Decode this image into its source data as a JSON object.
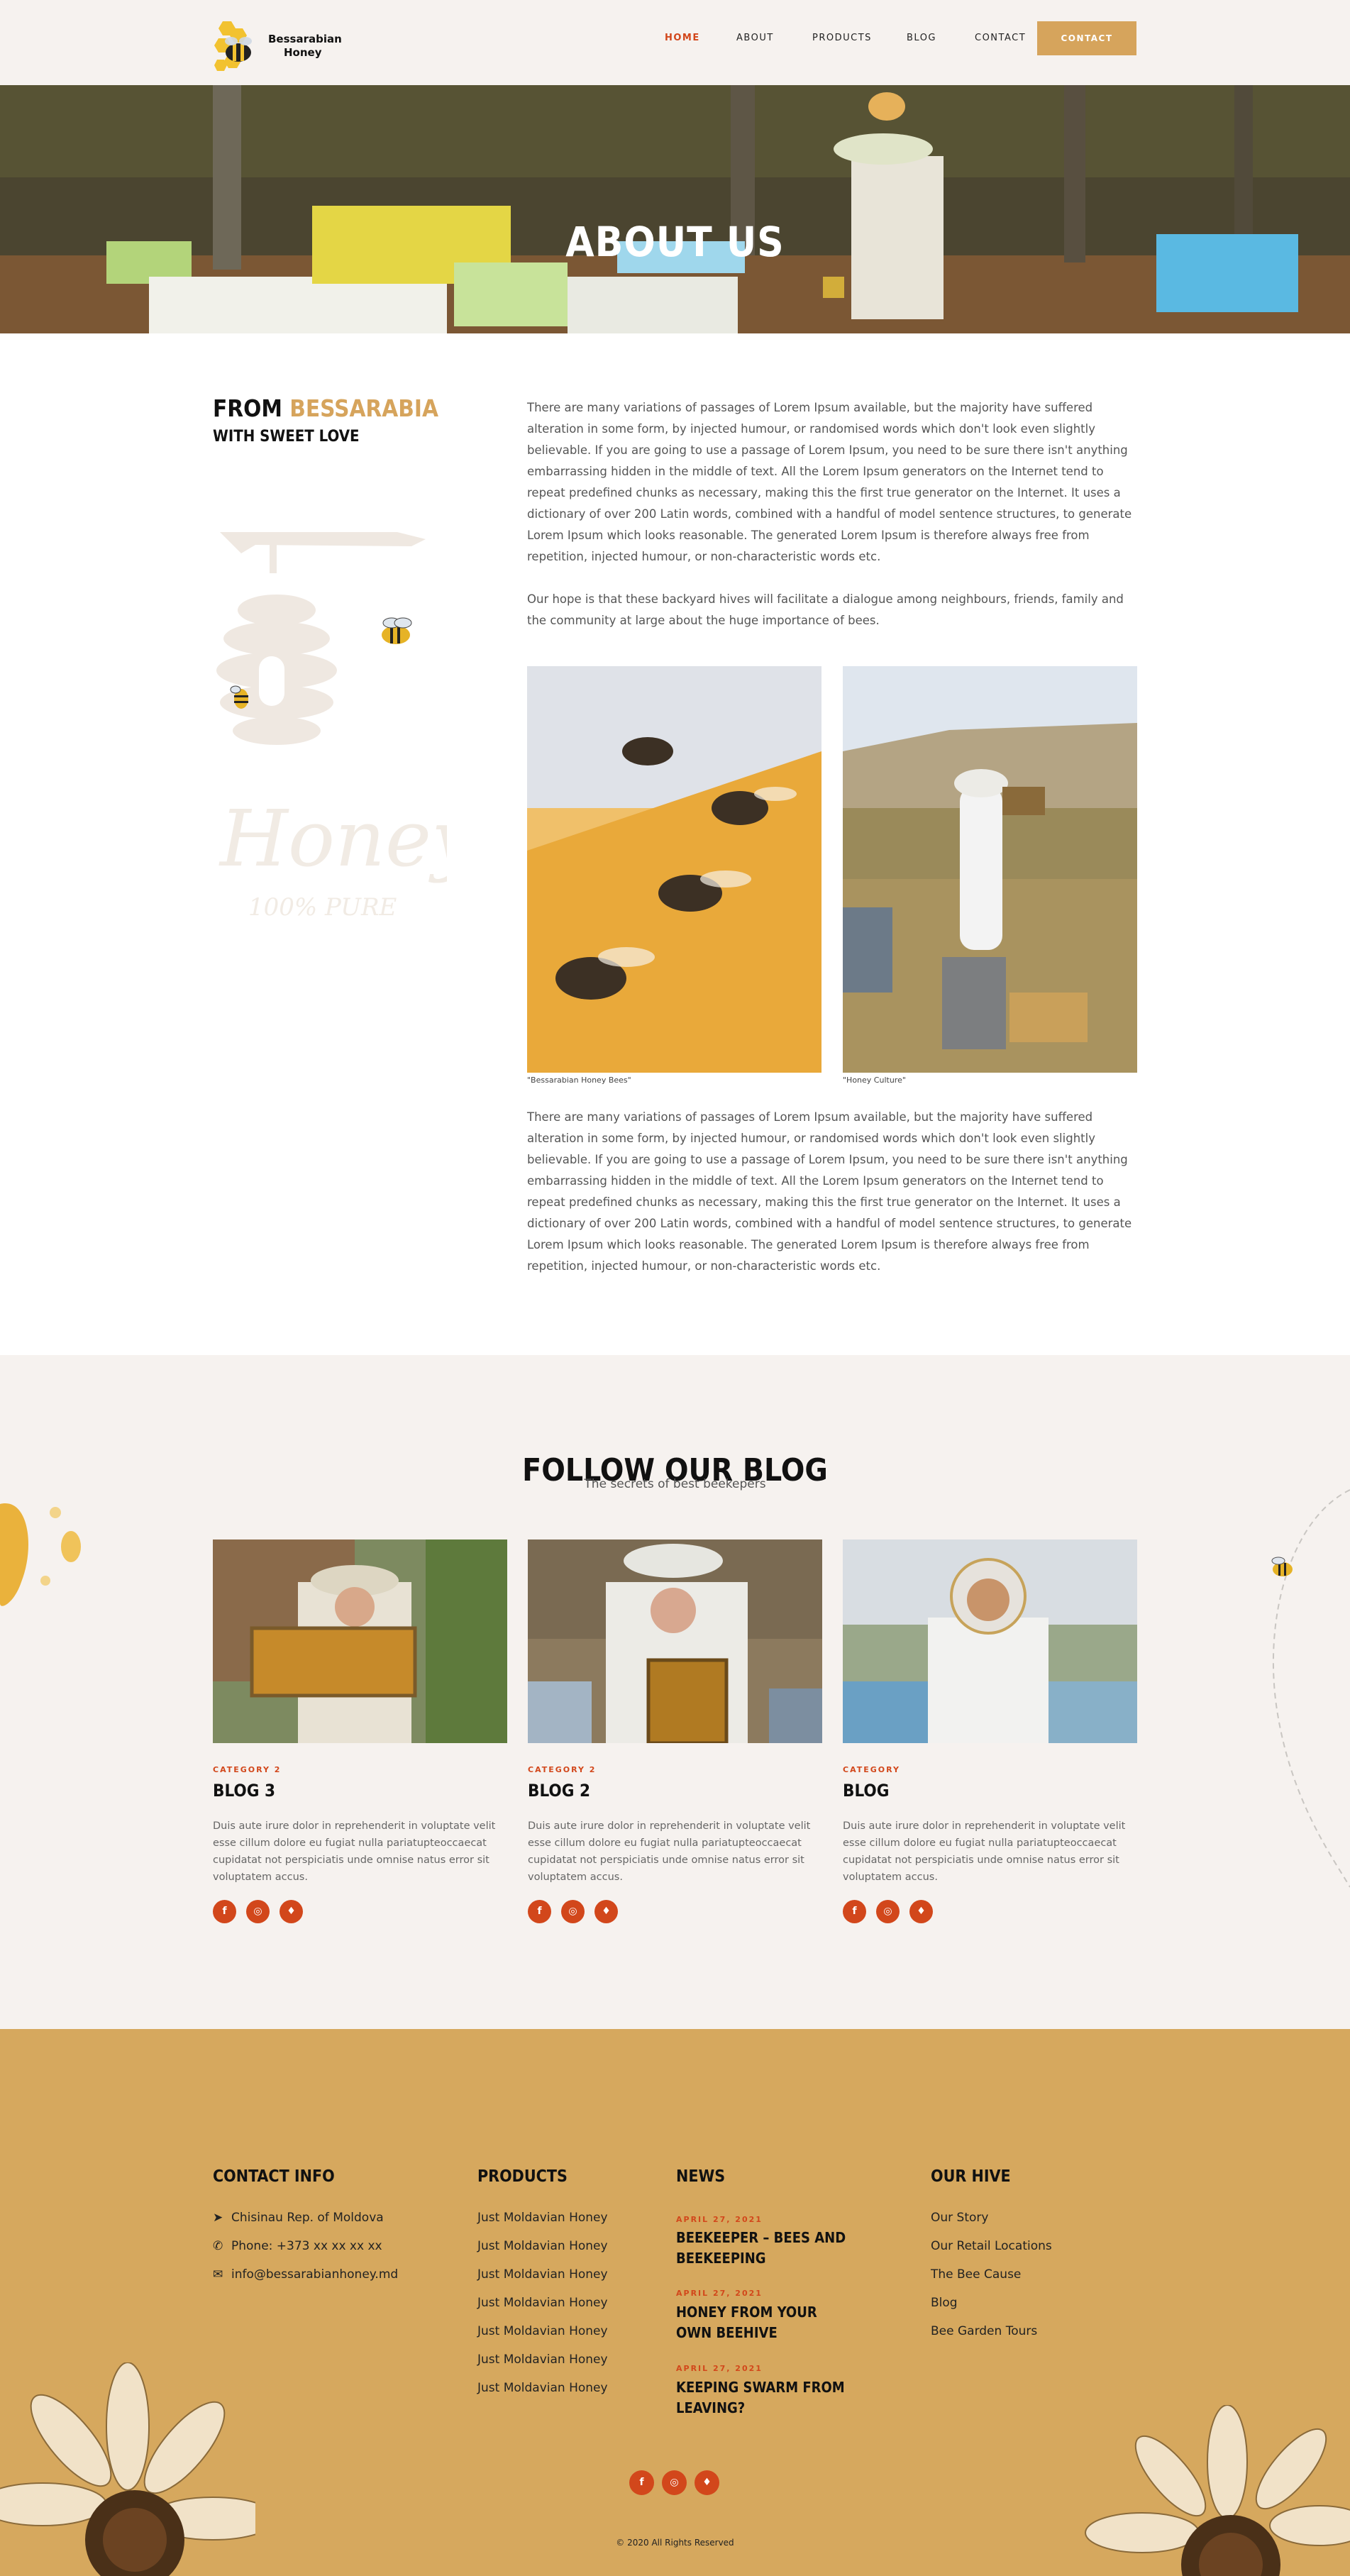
{
  "header": {
    "logo_line1": "Bessarabian",
    "logo_line2": "Honey",
    "nav": [
      "HOME",
      "ABOUT",
      "PRODUCTS",
      "BLOG",
      "CONTACT"
    ],
    "cta": "CONTACT"
  },
  "hero": {
    "title": "ABOUT US"
  },
  "about": {
    "heading_prefix": "FROM ",
    "heading_accent": "BESSARABIA",
    "subheading": "WITH SWEET LOVE",
    "decor_script": "Honey",
    "decor_sub": "100% PURE",
    "paragraph1": "There are many variations of passages of Lorem Ipsum available, but the majority have suffered alteration in some form, by injected humour, or randomised words which don't look even slightly believable. If you are going to use a passage of Lorem Ipsum, you need to be sure there isn't anything embarrassing hidden in the middle of text. All the Lorem Ipsum generators on the Internet tend to repeat predefined chunks as necessary, making this the first true generator on the Internet. It uses a dictionary of over 200 Latin words, combined with a handful of model sentence structures, to generate Lorem Ipsum which looks reasonable. The generated Lorem Ipsum is therefore always free from repetition, injected humour, or non-characteristic words etc.",
    "paragraph2": "Our hope is that these backyard hives will facilitate a dialogue among neighbours, friends, family and the community at large about the huge importance of bees.",
    "caption1": "\"Bessarabian Honey Bees\"",
    "caption2": "\"Honey Culture\"",
    "paragraph3": "There are many variations of passages of Lorem Ipsum available, but the majority have suffered alteration in some form, by injected humour, or randomised words which don't look even slightly believable. If you are going to use a passage of Lorem Ipsum, you need to be sure there isn't anything embarrassing hidden in the middle of text. All the Lorem Ipsum generators on the Internet tend to repeat predefined chunks as necessary, making this the first true generator on the Internet. It uses a dictionary of over 200 Latin words, combined with a handful of model sentence structures, to generate Lorem Ipsum which looks reasonable. The generated Lorem Ipsum is therefore always free from repetition, injected humour, or non-characteristic words etc."
  },
  "blog": {
    "title": "FOLLOW OUR BLOG",
    "subtitle": "The secrets of best beekepers",
    "cards": [
      {
        "category": "CATEGORY 2",
        "title": "BLOG 3",
        "text": "Duis aute irure dolor in reprehenderit in voluptate velit esse cillum dolore eu fugiat nulla pariatupteoccaecat cupidatat not perspiciatis unde omnise natus error sit voluptatem accus."
      },
      {
        "category": "CATEGORY 2",
        "title": "BLOG 2",
        "text": "Duis aute irure dolor in reprehenderit in voluptate velit esse cillum dolore eu fugiat nulla pariatupteoccaecat cupidatat not perspiciatis unde omnise natus error sit voluptatem accus."
      },
      {
        "category": "CATEGORY",
        "title": "BLOG",
        "text": "Duis aute irure dolor in reprehenderit in voluptate velit esse cillum dolore eu fugiat nulla pariatupteoccaecat cupidatat not perspiciatis unde omnise natus error sit voluptatem accus."
      }
    ],
    "social_icons": [
      "facebook-icon",
      "instagram-icon",
      "twitter-icon"
    ]
  },
  "footer": {
    "contact": {
      "heading": "CONTACT INFO",
      "address": "Chisinau Rep. of Moldova",
      "phone": "Phone: +373 xx xx xx xx",
      "email": "info@bessarabianhoney.md"
    },
    "products": {
      "heading": "PRODUCTS",
      "items": [
        "Just Moldavian Honey",
        "Just Moldavian Honey",
        "Just Moldavian Honey",
        "Just Moldavian Honey",
        "Just Moldavian Honey",
        "Just Moldavian Honey",
        "Just Moldavian Honey"
      ]
    },
    "news": {
      "heading": "NEWS",
      "items": [
        {
          "date": "APRIL 27, 2021",
          "title": "BEEKEEPER – BEES AND BEEKEEPING"
        },
        {
          "date": "APRIL 27, 2021",
          "title": "HONEY FROM YOUR OWN BEEHIVE"
        },
        {
          "date": "APRIL 27, 2021",
          "title": "KEEPING SWARM FROM LEAVING?"
        }
      ]
    },
    "hive": {
      "heading": "OUR HIVE",
      "items": [
        "Our Story",
        "Our Retail Locations",
        "The Bee Cause",
        "Blog",
        "Bee Garden Tours"
      ]
    },
    "copyright": "© 2020 All Rights Reserved"
  },
  "colors": {
    "accent_gold": "#d6a45c",
    "accent_red": "#d2471b",
    "section_bg": "#f6f2ef",
    "footer_bg": "#d6a85e"
  }
}
